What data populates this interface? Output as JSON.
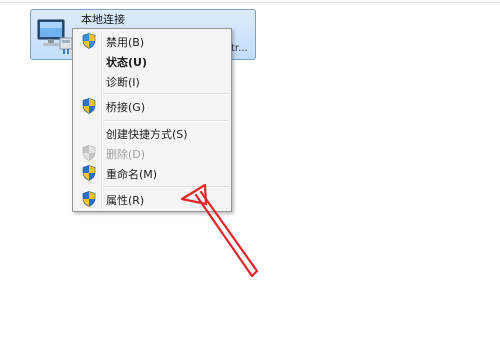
{
  "adapter": {
    "name": "本地连接",
    "line2": "...",
    "line3": "tr..."
  },
  "menu": {
    "items": [
      {
        "label": "禁用(B)",
        "icon": "shield-icon",
        "bold": false,
        "disabled": false
      },
      {
        "label": "状态(U)",
        "icon": null,
        "bold": true,
        "disabled": false
      },
      {
        "label": "诊断(I)",
        "icon": null,
        "bold": false,
        "disabled": false
      },
      {
        "label": "桥接(G)",
        "icon": "shield-icon",
        "bold": false,
        "disabled": false
      },
      {
        "label": "创建快捷方式(S)",
        "icon": null,
        "bold": false,
        "disabled": false
      },
      {
        "label": "删除(D)",
        "icon": "shield-icon",
        "bold": false,
        "disabled": true
      },
      {
        "label": "重命名(M)",
        "icon": "shield-icon",
        "bold": false,
        "disabled": false
      },
      {
        "label": "属性(R)",
        "icon": "shield-icon",
        "bold": false,
        "disabled": false
      }
    ]
  },
  "colors": {
    "annotation_arrow": "#e0262b",
    "selection": "#c4defa"
  }
}
